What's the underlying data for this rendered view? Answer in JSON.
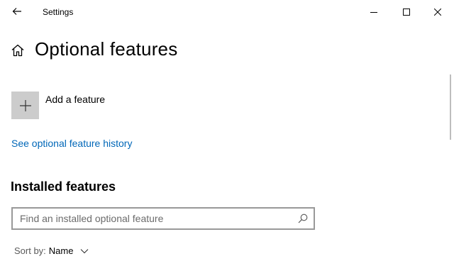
{
  "window": {
    "title": "Settings"
  },
  "page": {
    "title": "Optional features"
  },
  "add_feature": {
    "label": "Add a feature",
    "icon": "plus-icon"
  },
  "history_link": "See optional feature history",
  "installed": {
    "heading": "Installed features",
    "search_placeholder": "Find an installed optional feature",
    "search_value": ""
  },
  "sort": {
    "label": "Sort by:",
    "value": "Name"
  },
  "colors": {
    "accent_link": "#0067b8",
    "tile_bg": "#cccccc",
    "input_border": "#999999"
  }
}
